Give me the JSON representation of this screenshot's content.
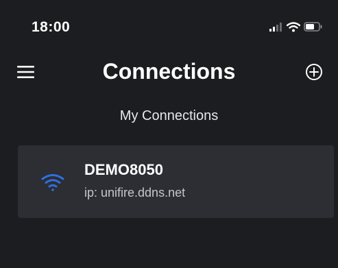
{
  "status_bar": {
    "time": "18:00",
    "icons": [
      "signal-icon",
      "wifi-icon",
      "battery-icon"
    ]
  },
  "header": {
    "title": "Connections",
    "left_icon": "menu-icon",
    "right_icon": "add-circle-icon"
  },
  "section": {
    "label": "My Connections"
  },
  "connections": [
    {
      "name": "DEMO8050",
      "ip_text": "ip: unifire.ddns.net",
      "icon": "wifi-icon"
    }
  ],
  "colors": {
    "background": "#1c1d20",
    "card": "#2c2e33",
    "accent": "#2f6fe0",
    "text": "#ffffff",
    "secondary_text": "#c5c7cc"
  }
}
